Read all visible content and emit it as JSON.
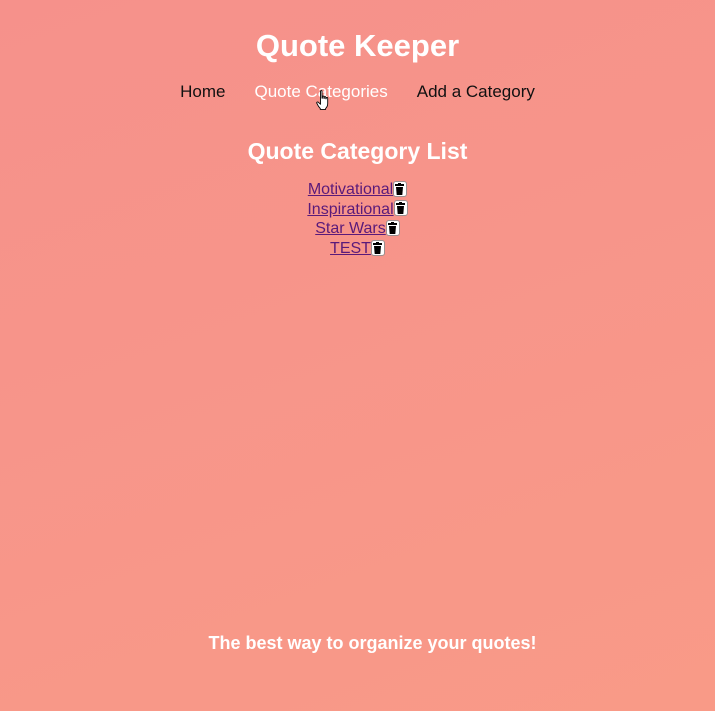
{
  "app": {
    "title": "Quote Keeper"
  },
  "nav": {
    "home": "Home",
    "quote_categories": "Quote Categories",
    "add_category": "Add a Category"
  },
  "main": {
    "section_title": "Quote Category List",
    "categories": [
      {
        "name": "Motivational",
        "delete_icon": "trash-icon"
      },
      {
        "name": "Inspirational",
        "delete_icon": "trash-icon"
      },
      {
        "name": "Star Wars",
        "delete_icon": "trash-icon"
      },
      {
        "name": "TEST",
        "delete_icon": "trash-icon"
      }
    ]
  },
  "footer": {
    "tagline": "The best way to organize your quotes!"
  },
  "colors": {
    "background_start": "#f6918b",
    "background_end": "#f99a87",
    "title_text": "#ffffff",
    "nav_text": "#111111",
    "active_nav_text": "#ffffff",
    "link_text": "#5a1a7a"
  },
  "cursor": {
    "icon": "hand-pointer-icon"
  }
}
